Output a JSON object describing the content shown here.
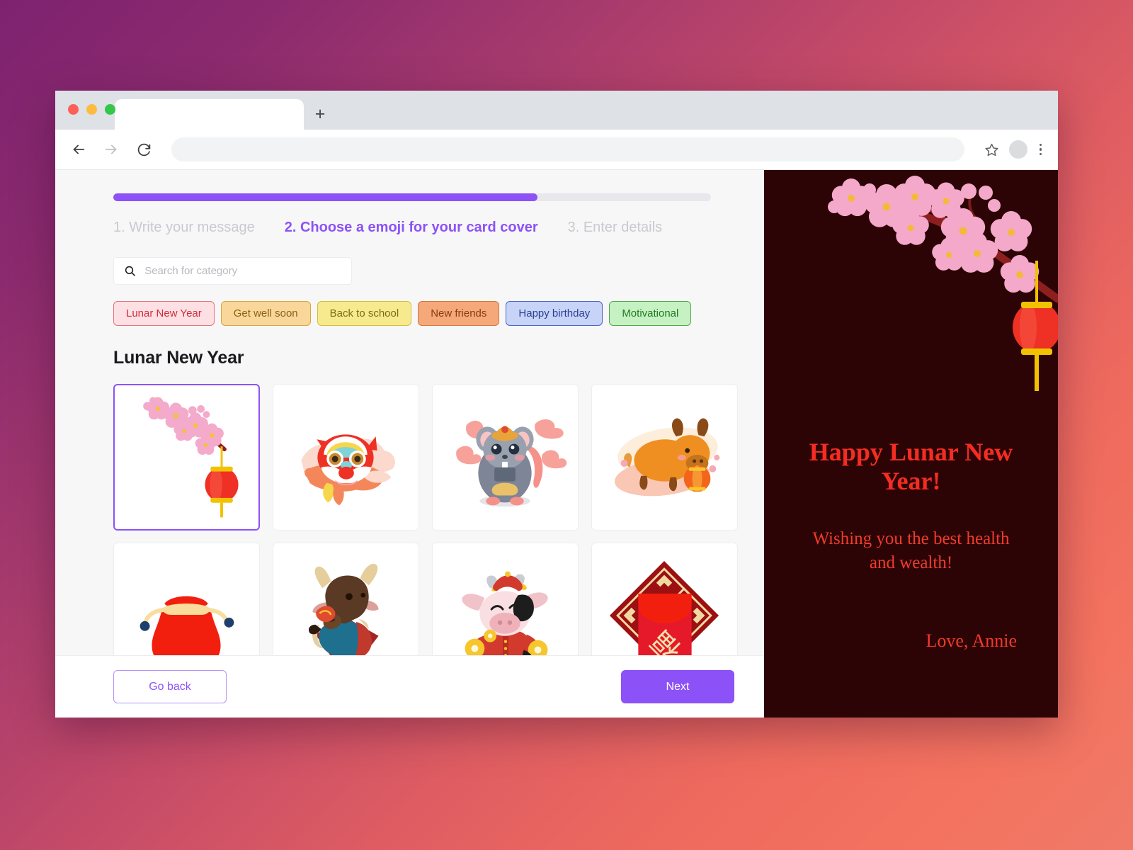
{
  "browser": {
    "tab_title": "",
    "url_value": "",
    "url_placeholder": "",
    "new_tab_label": "+",
    "back_icon": "back-arrow-icon",
    "forward_icon": "forward-arrow-icon",
    "reload_icon": "reload-icon",
    "bookmark_icon": "star-icon",
    "menu_icon": "kebab-menu-icon"
  },
  "wizard": {
    "progress_percent": 71,
    "steps": [
      {
        "label": "1. Write your message",
        "active": false
      },
      {
        "label": "2. Choose a emoji for your card cover",
        "active": true
      },
      {
        "label": "3.  Enter details",
        "active": false
      }
    ]
  },
  "search": {
    "placeholder": "Search for category",
    "value": "",
    "icon": "search-icon"
  },
  "categories": [
    {
      "label": "Lunar New Year",
      "bg": "#fde0e3",
      "border": "#e8707f",
      "color": "#cf2b3c",
      "selected": true
    },
    {
      "label": "Get well soon",
      "bg": "#f9d79a",
      "border": "#d9a43f",
      "color": "#8a6214",
      "selected": false
    },
    {
      "label": "Back to school",
      "bg": "#f7ea8e",
      "border": "#cfc03c",
      "color": "#7a6d10",
      "selected": false
    },
    {
      "label": "New friends",
      "bg": "#f5a97a",
      "border": "#d4753c",
      "color": "#8a3c10",
      "selected": false
    },
    {
      "label": "Happy birthday",
      "bg": "#c7d3f7",
      "border": "#4a64c4",
      "color": "#2a3f94",
      "selected": false
    },
    {
      "label": "Motivational",
      "bg": "#c6f2c3",
      "border": "#4fa84a",
      "color": "#217a22",
      "selected": false
    }
  ],
  "section": {
    "title": "Lunar New Year"
  },
  "emoji_tiles": [
    {
      "name": "cherry-blossom-lantern",
      "selected": true
    },
    {
      "name": "lion-dance",
      "selected": false
    },
    {
      "name": "rat-with-ingot",
      "selected": false
    },
    {
      "name": "orange-ox-lantern",
      "selected": false
    },
    {
      "name": "red-money-bag",
      "selected": false
    },
    {
      "name": "ox-in-hanfu",
      "selected": false
    },
    {
      "name": "cow-with-coins",
      "selected": false
    },
    {
      "name": "red-envelope-fu",
      "selected": false
    }
  ],
  "footer": {
    "back_label": "Go back",
    "next_label": "Next"
  },
  "card": {
    "title": "Happy Lunar New Year!",
    "message": "Wishing you the best health and wealth!",
    "signature": "Love, Annie",
    "background": "#2d0406",
    "title_color": "#f52c22",
    "art": "cherry-blossom-lantern-art"
  },
  "theme": {
    "accent": "#8c52f7",
    "page_bg_start": "#7e2270",
    "page_bg_end": "#f07a68"
  }
}
